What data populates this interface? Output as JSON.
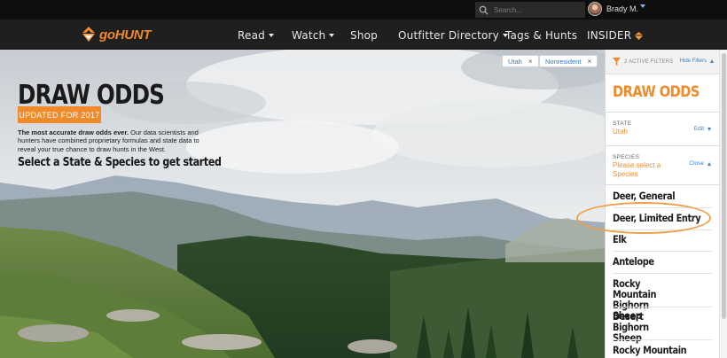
{
  "topbar": {
    "search_placeholder": "Search...",
    "user_name": "Brady M."
  },
  "nav": {
    "logo": "goHUNT",
    "items": [
      "Read",
      "Watch",
      "Shop",
      "Outfitter Directory",
      "Tags & Hunts",
      "INSIDER"
    ]
  },
  "hero": {
    "title": "DRAW ODDS",
    "badge": "UPDATED FOR 2017",
    "desc_bold": "The most accurate draw odds ever.",
    "desc_rest": " Our data scientists and hunters have combined proprietary formulas and state data to reveal your true chance to draw hunts in the West.",
    "cta": "Select a State & Species to get started",
    "chips": [
      "Utah",
      "Nonresident"
    ]
  },
  "sidebar": {
    "active_filters": "2 ACTIVE FILTERS",
    "hide_filters": "Hide Filters",
    "title": "DRAW ODDS",
    "state_label": "STATE",
    "state_value": "Utah",
    "state_edit": "Edit",
    "species_label": "SPECIES",
    "species_prompt": "Please select a Species",
    "species_close": "Close",
    "species": [
      "Deer, General",
      "Deer, Limited Entry",
      "Elk",
      "Antelope",
      "Rocky Mountain Bighorn Sheep",
      "Desert Bighorn Sheep",
      "Rocky Mountain"
    ]
  },
  "colors": {
    "accent": "#f08a2a",
    "link": "#3b82c4",
    "nav_bg": "#1f1f1f"
  }
}
